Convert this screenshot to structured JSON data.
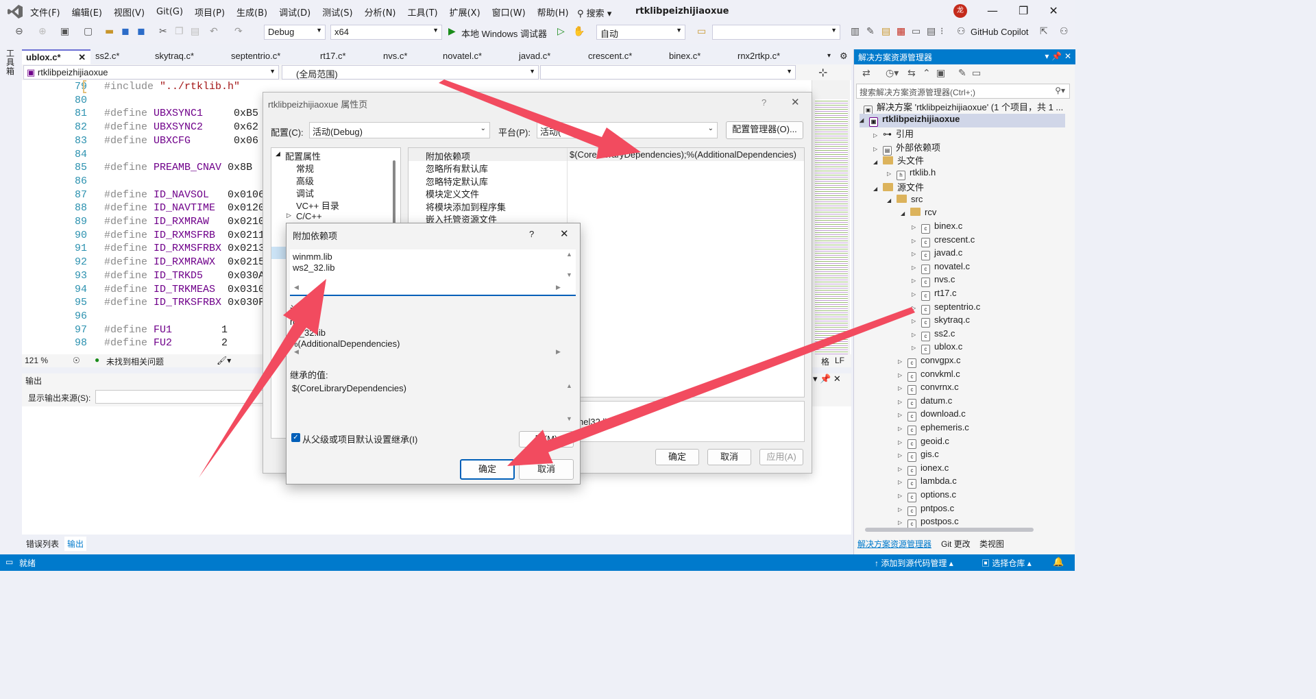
{
  "menubar": {
    "items": [
      "文件(F)",
      "编辑(E)",
      "视图(V)",
      "Git(G)",
      "项目(P)",
      "生成(B)",
      "调试(D)",
      "测试(S)",
      "分析(N)",
      "工具(T)",
      "扩展(X)",
      "窗口(W)",
      "帮助(H)"
    ],
    "search": "搜索",
    "solution_title": "rtklibpeizhijiaoxue",
    "avatar": "龙"
  },
  "toolbar": {
    "config": "Debug",
    "platform": "x64",
    "run": "本地 Windows 调试器",
    "auto": "自动",
    "copilot": "GitHub Copilot"
  },
  "left_tool": "工具箱",
  "tabs": [
    "ublox.c*",
    "ss2.c*",
    "skytraq.c*",
    "septentrio.c*",
    "rt17.c*",
    "nvs.c*",
    "novatel.c*",
    "javad.c*",
    "crescent.c*",
    "binex.c*",
    "rnx2rtkp.c*"
  ],
  "nav": {
    "project": "rtklibpeizhijiaoxue",
    "scope": "(全局范围)"
  },
  "code": [
    {
      "n": "79",
      "t": "#include \"../rtklib.h\""
    },
    {
      "n": "80",
      "t": ""
    },
    {
      "n": "81",
      "t": "#define UBXSYNC1     0xB5"
    },
    {
      "n": "82",
      "t": "#define UBXSYNC2     0x62"
    },
    {
      "n": "83",
      "t": "#define UBXCFG       0x06"
    },
    {
      "n": "84",
      "t": ""
    },
    {
      "n": "85",
      "t": "#define PREAMB_CNAV 0x8B"
    },
    {
      "n": "86",
      "t": ""
    },
    {
      "n": "87",
      "t": "#define ID_NAVSOL   0x0106"
    },
    {
      "n": "88",
      "t": "#define ID_NAVTIME  0x0120"
    },
    {
      "n": "89",
      "t": "#define ID_RXMRAW   0x0210"
    },
    {
      "n": "90",
      "t": "#define ID_RXMSFRB  0x0211"
    },
    {
      "n": "91",
      "t": "#define ID_RXMSFRBX 0x0213"
    },
    {
      "n": "92",
      "t": "#define ID_RXMRAWX  0x0215"
    },
    {
      "n": "93",
      "t": "#define ID_TRKD5    0x030A"
    },
    {
      "n": "94",
      "t": "#define ID_TRKMEAS  0x0310"
    },
    {
      "n": "95",
      "t": "#define ID_TRKSFRBX 0x030F"
    },
    {
      "n": "96",
      "t": ""
    },
    {
      "n": "97",
      "t": "#define FU1        1"
    },
    {
      "n": "98",
      "t": "#define FU2        2"
    }
  ],
  "editor_status": {
    "zoom": "121 %",
    "issues": "未找到相关问题",
    "right": "格",
    "lf": "LF"
  },
  "output": {
    "title": "输出",
    "source_label": "显示输出来源(S):"
  },
  "bottom_tabs": [
    "错误列表",
    "输出"
  ],
  "status": {
    "ready": "就绪",
    "add_source": "添加到源代码管理",
    "select_repo": "选择仓库"
  },
  "solution": {
    "header": "解决方案资源管理器",
    "search_placeholder": "搜索解决方案资源管理器(Ctrl+;)",
    "solution_line": "解决方案 'rtklibpeizhijiaoxue' (1 个项目，共 1 ...",
    "project": "rtklibpeizhijiaoxue",
    "ref": "引用",
    "ext": "外部依赖项",
    "headers": "头文件",
    "rtklib_h": "rtklib.h",
    "source": "源文件",
    "src": "src",
    "rcv": "rcv",
    "rcv_files": [
      "binex.c",
      "crescent.c",
      "javad.c",
      "novatel.c",
      "nvs.c",
      "rt17.c",
      "septentrio.c",
      "skytraq.c",
      "ss2.c",
      "ublox.c"
    ],
    "src_files": [
      "convgpx.c",
      "convkml.c",
      "convrnx.c",
      "datum.c",
      "download.c",
      "ephemeris.c",
      "geoid.c",
      "gis.c",
      "ionex.c",
      "lambda.c",
      "options.c",
      "pntpos.c",
      "postpos.c"
    ],
    "footer": [
      "解决方案资源管理器",
      "Git 更改",
      "类视图"
    ]
  },
  "prop": {
    "title": "rtklibpeizhijiaoxue 属性页",
    "config_label": "配置(C):",
    "config_value": "活动(Debug)",
    "platform_label": "平台(P):",
    "platform_value": "活动(",
    "manager": "配置管理器(O)...",
    "tree": [
      "配置属性",
      "常规",
      "高级",
      "调试",
      "VC++ 目录",
      "C/C++"
    ],
    "rows": [
      "附加依赖项",
      "忽略所有默认库",
      "忽略特定默认库",
      "模块定义文件",
      "将模块添加到程序集",
      "嵌入托管资源文件"
    ],
    "value": "$(CoreLibraryDependencies);%(AdditionalDependencies)",
    "partial": "nel32.li",
    "ok": "确定",
    "cancel": "取消",
    "apply": "应用(A)"
  },
  "dialog": {
    "title": "附加依赖项",
    "help": "?",
    "close": "✕",
    "lines": [
      "winmm.lib",
      "ws2_32.lib"
    ],
    "computed_label": "计",
    "computed": [
      "mm.lib",
      "s2_32.lib",
      "%(AdditionalDependencies)"
    ],
    "inherit_label": "继承的值:",
    "inherited": "$(CoreLibraryDependencies)",
    "checkbox": "从父级或项目默认设置继承(I)",
    "macro": "宏(M)",
    "ok": "确定",
    "cancel": "取消"
  },
  "colors": {
    "accent": "#007acc",
    "arrow": "#f24b5f"
  }
}
